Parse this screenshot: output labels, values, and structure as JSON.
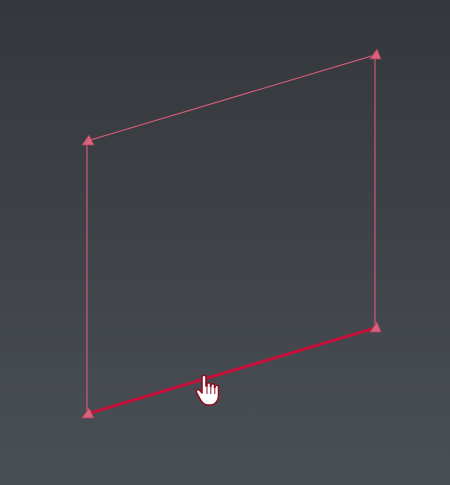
{
  "viewport": {
    "background_top": "#34373b",
    "background_bottom": "#4a4f56"
  },
  "selection": {
    "edge_color": "#e4607a",
    "highlight_color": "#c8103a",
    "vertex_color": "#d9627c",
    "hovered_edge": "bottom"
  },
  "cursor": {
    "icon": "hand-pointer-icon"
  }
}
